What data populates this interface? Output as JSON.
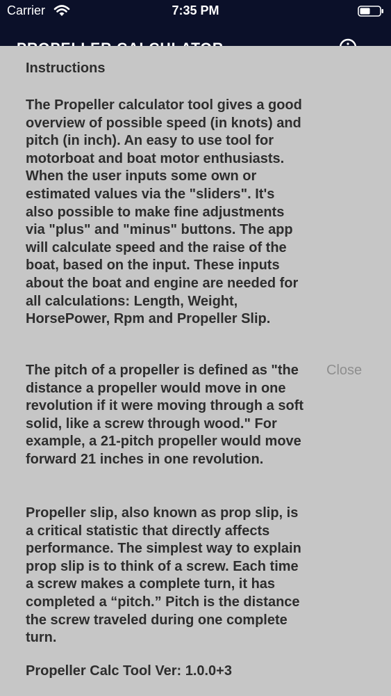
{
  "status_bar": {
    "carrier": "Carrier",
    "time": "7:35 PM",
    "wifi_icon": "wifi-icon",
    "battery_icon": "battery-icon"
  },
  "nav": {
    "title": "PROPELLER CALCULATOR",
    "info_icon": "info-icon"
  },
  "sheet": {
    "title": "Instructions",
    "paragraphs": [
      " The Propeller calculator tool gives a good overview of possible speed (in knots) and pitch (in inch). An easy to use tool for motorboat and boat motor enthusiasts. When the user inputs some own or estimated values via the \"sliders\". It's also possible to make fine adjustments via \"plus\" and \"minus\" buttons. The app will calculate speed and the raise of the boat, based on the input. These inputs about the boat and engine are needed for all calculations: Length, Weight, HorsePower, Rpm and Propeller Slip.",
      "The pitch of a propeller is defined as \"the distance a propeller would move in one revolution if it were moving through a soft solid, like a screw through wood.\" For example, a 21-pitch propeller would move forward 21 inches in one revolution.",
      "Propeller slip, also known as prop slip, is a critical statistic that directly affects performance. The simplest way to explain prop slip is to think of a screw. Each time a screw makes a complete turn, it has completed a “pitch.” Pitch is the distance the screw traveled during one complete turn."
    ],
    "version": "Propeller Calc Tool Ver: 1.0.0+3",
    "close_label": "Close"
  },
  "colors": {
    "nav_background": "#0b1029",
    "sheet_background": "#c6c6c6",
    "text": "#2d2d2d",
    "close_text": "#8e8e8e"
  }
}
